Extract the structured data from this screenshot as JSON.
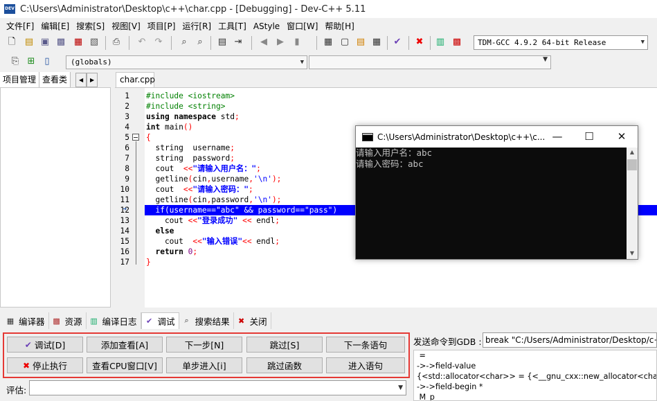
{
  "window": {
    "title": "C:\\Users\\Administrator\\Desktop\\c++\\char.cpp - [Debugging] - Dev-C++ 5.11",
    "app_icon": "DEV"
  },
  "menu": [
    "文件[F]",
    "编辑[E]",
    "搜索[S]",
    "视图[V]",
    "项目[P]",
    "运行[R]",
    "工具[T]",
    "AStyle",
    "窗口[W]",
    "帮助[H]"
  ],
  "toolbar": {
    "compiler": "TDM-GCC 4.9.2 64-bit Release",
    "scope": "(globals)",
    "icons": [
      "new-file-icon",
      "open-file-icon",
      "save-icon",
      "save-all-icon",
      "close-file-icon",
      "print-icon",
      "undo-icon",
      "redo-icon",
      "find-icon",
      "replace-icon",
      "goto-icon",
      "indent-icon",
      "unindent-icon",
      "toggle-comment-icon",
      "grid-icon",
      "window-icon",
      "color-icon",
      "tile-icon",
      "check-icon",
      "stop-icon",
      "chart-icon",
      "profile-icon"
    ]
  },
  "left_panel": {
    "tabs": [
      "项目管理",
      "查看类"
    ]
  },
  "editor": {
    "tab": "char.cpp",
    "highlight_line": 12,
    "lines": [
      {
        "n": "1",
        "parts": [
          [
            "#include <iostream>",
            "pp"
          ]
        ]
      },
      {
        "n": "2",
        "parts": [
          [
            "#include <string>",
            "pp"
          ]
        ]
      },
      {
        "n": "3",
        "parts": [
          [
            "using namespace",
            "kw"
          ],
          [
            " std",
            "plain"
          ],
          [
            ";",
            "op"
          ]
        ]
      },
      {
        "n": "4",
        "parts": [
          [
            "int",
            "kw"
          ],
          [
            " main",
            "plain"
          ],
          [
            "()",
            "op"
          ]
        ]
      },
      {
        "n": "5",
        "parts": [
          [
            "{",
            "op"
          ]
        ]
      },
      {
        "n": "6",
        "parts": [
          [
            "  string  username",
            "plain"
          ],
          [
            ";",
            "op"
          ]
        ]
      },
      {
        "n": "7",
        "parts": [
          [
            "  string  password",
            "plain"
          ],
          [
            ";",
            "op"
          ]
        ]
      },
      {
        "n": "8",
        "parts": [
          [
            "  cout  ",
            "plain"
          ],
          [
            "<<",
            "op"
          ],
          [
            "\"请输入用户名：\"",
            "str"
          ],
          [
            ";",
            "op"
          ]
        ]
      },
      {
        "n": "9",
        "parts": [
          [
            "  getline",
            "plain"
          ],
          [
            "(",
            "op"
          ],
          [
            "cin",
            "plain"
          ],
          [
            ",",
            "op"
          ],
          [
            "username",
            "plain"
          ],
          [
            ",",
            "op"
          ],
          [
            "'\\n'",
            "ch"
          ],
          [
            ");",
            "op"
          ]
        ]
      },
      {
        "n": "10",
        "parts": [
          [
            "  cout  ",
            "plain"
          ],
          [
            "<<",
            "op"
          ],
          [
            "\"请输入密码：\"",
            "str"
          ],
          [
            ";",
            "op"
          ]
        ]
      },
      {
        "n": "11",
        "parts": [
          [
            "  getline",
            "plain"
          ],
          [
            "(",
            "op"
          ],
          [
            "cin",
            "plain"
          ],
          [
            ",",
            "op"
          ],
          [
            "password",
            "plain"
          ],
          [
            ",",
            "op"
          ],
          [
            "'\\n'",
            "ch"
          ],
          [
            ");",
            "op"
          ]
        ]
      },
      {
        "n": "12",
        "parts": [
          [
            "  if(username==\"abc\" && password==\"pass\")",
            "plain"
          ]
        ]
      },
      {
        "n": "13",
        "parts": [
          [
            "    cout ",
            "plain"
          ],
          [
            "<<",
            "op"
          ],
          [
            "\"登录成功\"",
            "str"
          ],
          [
            " << ",
            "op"
          ],
          [
            "endl",
            "plain"
          ],
          [
            ";",
            "op"
          ]
        ]
      },
      {
        "n": "14",
        "parts": [
          [
            "  else",
            "kw"
          ]
        ]
      },
      {
        "n": "15",
        "parts": [
          [
            "    cout  ",
            "plain"
          ],
          [
            "<<",
            "op"
          ],
          [
            "\"输入错误\"",
            "str"
          ],
          [
            "<< ",
            "op"
          ],
          [
            "endl",
            "plain"
          ],
          [
            ";",
            "op"
          ]
        ]
      },
      {
        "n": "16",
        "parts": [
          [
            "  return",
            "kw"
          ],
          [
            " ",
            "plain"
          ],
          [
            "0",
            "num"
          ],
          [
            ";",
            "op"
          ]
        ]
      },
      {
        "n": "17",
        "parts": [
          [
            "}",
            "op"
          ]
        ]
      }
    ]
  },
  "console": {
    "title": "C:\\Users\\Administrator\\Desktop\\c++\\c...",
    "lines": [
      "请输入用户名：abc",
      "请输入密码：abc"
    ]
  },
  "bottom_tabs": [
    {
      "label": "编译器",
      "icon": "grid-icon"
    },
    {
      "label": "资源",
      "icon": "resource-icon"
    },
    {
      "label": "编译日志",
      "icon": "chart-icon"
    },
    {
      "label": "调试",
      "icon": "check-icon"
    },
    {
      "label": "搜索结果",
      "icon": "search-icon"
    },
    {
      "label": "关闭",
      "icon": "close-tab-icon"
    }
  ],
  "debug": {
    "buttons_row1": [
      "调试[D]",
      "添加查看[A]",
      "下一步[N]",
      "跳过[S]",
      "下一条语句"
    ],
    "buttons_row2": [
      "停止执行",
      "查看CPU窗口[V]",
      "单步进入[i]",
      "跳过函数",
      "进入语句"
    ],
    "eval_label": "评估:",
    "gdb_label": "发送命令到GDB :",
    "gdb_command": "break \"C:/Users/Administrator/Desktop/c++/char.cpp\"",
    "gdb_output": [
      " =",
      "->->field-value",
      "{<std::allocator<char>> = {<__gnu_cxx::new_allocator<char>> = {<No data fields>}, <No data fields>}",
      "->->field-begin *",
      " M_p"
    ]
  }
}
